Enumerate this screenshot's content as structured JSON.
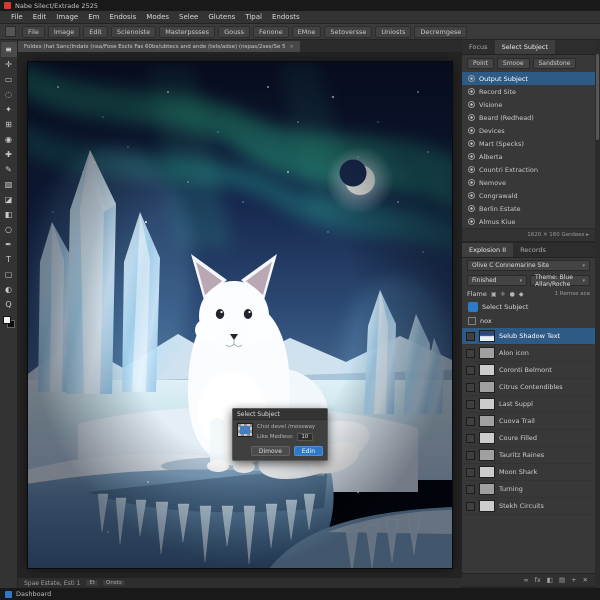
{
  "window": {
    "title": "Nabe Silect/Extrade 2525"
  },
  "colors": {
    "accent_blue": "#2f79c9",
    "selection_blue": "#2e5a86",
    "aurora_green": "#35e0a2",
    "panel_gray": "#383838"
  },
  "menubar": {
    "items": [
      "File",
      "Edit",
      "Image",
      "Em",
      "Endosis",
      "Modes",
      "Selee",
      "Glutens",
      "Tipal",
      "Endosts"
    ]
  },
  "optionsbar": {
    "items": [
      "File",
      "Image",
      "Edit",
      "Scienoiste",
      "Masterpssses",
      "Gouss",
      "Fenone",
      "EMne",
      "Setoversse",
      "Uniosts",
      "Decremgese"
    ]
  },
  "doc_tab": {
    "label": "Foldes (hat Sanc/Indats (nsa/Fose Escts Fas 60bs/ubtecs and ande (tels/adse) (nspas/2ses/Se 5",
    "close": "✕"
  },
  "tools": [
    {
      "glyph": "≡",
      "name": "toolbar-menu-icon"
    },
    {
      "glyph": "✛",
      "name": "move-tool-icon"
    },
    {
      "glyph": "▭",
      "name": "marquee-tool-icon"
    },
    {
      "glyph": "◌",
      "name": "lasso-tool-icon"
    },
    {
      "glyph": "✦",
      "name": "magic-wand-tool-icon"
    },
    {
      "glyph": "⊞",
      "name": "crop-tool-icon"
    },
    {
      "glyph": "◉",
      "name": "eyedropper-tool-icon"
    },
    {
      "glyph": "✚",
      "name": "healing-brush-tool-icon"
    },
    {
      "glyph": "✎",
      "name": "brush-tool-icon"
    },
    {
      "glyph": "▨",
      "name": "clone-stamp-tool-icon"
    },
    {
      "glyph": "◪",
      "name": "eraser-tool-icon"
    },
    {
      "glyph": "◧",
      "name": "gradient-tool-icon"
    },
    {
      "glyph": "○",
      "name": "blur-tool-icon"
    },
    {
      "glyph": "✒",
      "name": "pen-tool-icon"
    },
    {
      "glyph": "T",
      "name": "type-tool-icon"
    },
    {
      "glyph": "▢",
      "name": "shape-tool-icon"
    },
    {
      "glyph": "◐",
      "name": "hand-tool-icon"
    },
    {
      "glyph": "Q",
      "name": "zoom-tool-icon"
    }
  ],
  "dialog": {
    "title": "Select Subject",
    "line1": "Choi devel /mossway",
    "field_label": "Like   Medless:",
    "field_value": "10",
    "cancel_label": "Dimove",
    "ok_label": "Edin"
  },
  "panel_select": {
    "tabs": [
      {
        "label": "Focus"
      },
      {
        "label": "Select Subject",
        "selected": true
      }
    ],
    "subtabs": [
      "Point",
      "Smooe",
      "Sandstone"
    ],
    "rows": [
      {
        "label": "Output Subject",
        "selected": true
      },
      {
        "label": "Record Site"
      },
      {
        "label": "Visione"
      },
      {
        "label": "Beard (Redhead)"
      },
      {
        "label": "Devices"
      },
      {
        "label": "Mart (Specks)"
      },
      {
        "label": "Alberta"
      },
      {
        "label": "Countri Extraction"
      },
      {
        "label": "Nemove"
      },
      {
        "label": "Congrawald"
      },
      {
        "label": "Berlin Estate"
      },
      {
        "label": "Almus Kiue"
      }
    ],
    "footer": "1620 ✕  160 Gerdees  ▸"
  },
  "panel_layers": {
    "tabs": [
      {
        "label": "Explosion II",
        "selected": true
      },
      {
        "label": "Records"
      }
    ],
    "blend_row": {
      "value": "Olive C Connemarine Site",
      "chevron": "▾"
    },
    "lock_row": {
      "left": "Finished",
      "right": "Theme: Blue Allan/Roche",
      "chevron": "▾"
    },
    "flame_row": {
      "label": "Flame",
      "icons": [
        "▣",
        "✛",
        "●",
        "◆"
      ],
      "right": "1 Remse ace"
    },
    "pinned": [
      {
        "label": "Select Subject",
        "kind": "thumb-blue"
      },
      {
        "label": "nox",
        "kind": "thumb-check"
      }
    ],
    "layers": [
      {
        "name": "Selub Shadow Text",
        "thumb": "thumb-fox",
        "selected": true
      },
      {
        "name": "Alon icon",
        "thumb": "thumb-gray"
      },
      {
        "name": "Coronti Belmont",
        "thumb": "thumb-light"
      },
      {
        "name": "Citrus Contendibles",
        "thumb": "thumb-gray"
      },
      {
        "name": "Last Suppl",
        "thumb": "thumb-light"
      },
      {
        "name": "Cuova Trail",
        "thumb": "thumb-gray"
      },
      {
        "name": "Coure Filled",
        "thumb": "thumb-light"
      },
      {
        "name": "Tauritz Raines",
        "thumb": "thumb-gray"
      },
      {
        "name": "Moon Shark",
        "thumb": "thumb-light"
      },
      {
        "name": "Turning",
        "thumb": "thumb-gray"
      },
      {
        "name": "Stekh Circuits",
        "thumb": "thumb-light"
      }
    ],
    "footer_icons": [
      "∞",
      "fx",
      "◧",
      "▤",
      "+",
      "✕"
    ]
  },
  "doc_status": {
    "left": "Spae Estate, Esti 1",
    "items": [
      "Et",
      "Onsts"
    ]
  },
  "statusbar": {
    "left": "Dashboard"
  }
}
